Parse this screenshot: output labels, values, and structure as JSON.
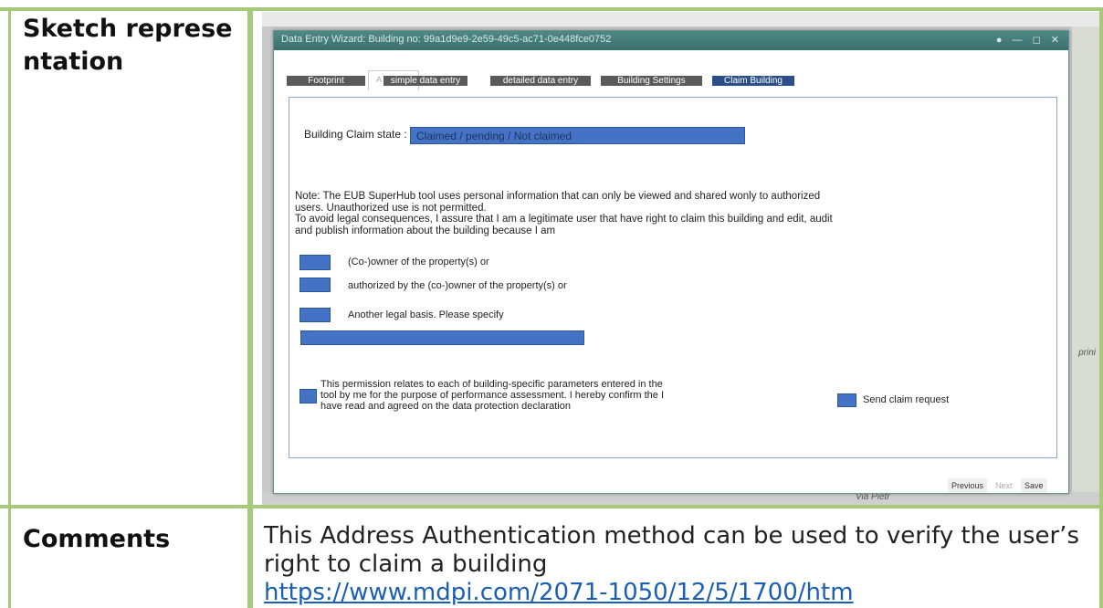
{
  "table": {
    "row1_label": "Sketch representation",
    "row2_label": "Comments",
    "comment_text": "This Address Authentication method can be used to verify the user’s right to claim a building",
    "comment_link": "https://www.mdpi.com/2071-1050/12/5/1700/htm"
  },
  "wizard": {
    "title": "Data Entry Wizard: Building no: 99a1d9e9-2e59-49c5-ac71-0e448fce0752",
    "controls": "● — ◻ ✕",
    "tabs": {
      "footprint": "Footprint",
      "hidden": "A",
      "simple": "simple data entry",
      "detailed": "detailed data entry",
      "settings": "Building Settings",
      "claim": "Claim Building"
    },
    "claim_state_label": "Building Claim state :",
    "claim_state_value": "Claimed / pending / Not claimed",
    "note_line1": "Note: The EUB SuperHub tool  uses personal information that can only be viewed and shared wonly to authorized users. Unauthorized use is not permitted.",
    "note_line2": "To avoid legal consequences, I assure that I am a legitimate user that have right to claim this building and edit, audit and publish information about the building because I am",
    "option_owner": "(Co-)owner of the property(s) or",
    "option_authorized": "authorized by the (co-)owner of the property(s) or",
    "option_other": "Another legal basis. Please specify",
    "permission_text": "This permission relates to each of building-specific parameters entered in the tool by me for the purpose of performance  assessment. I hereby confirm the I have read and agreed on the data protection declaration",
    "send_label": "Send claim request",
    "btn_previous": "Previous",
    "btn_next": "Next",
    "btn_save": "Save"
  },
  "map_fragments": {
    "right": "prini",
    "bottom": "Via Pietr"
  },
  "colors": {
    "table_border": "#a6ca7a",
    "titlebar": "#3b6f6c",
    "field_blue": "#4472c4",
    "active_tab": "#2b4f8a",
    "link": "#1a5fb4"
  }
}
